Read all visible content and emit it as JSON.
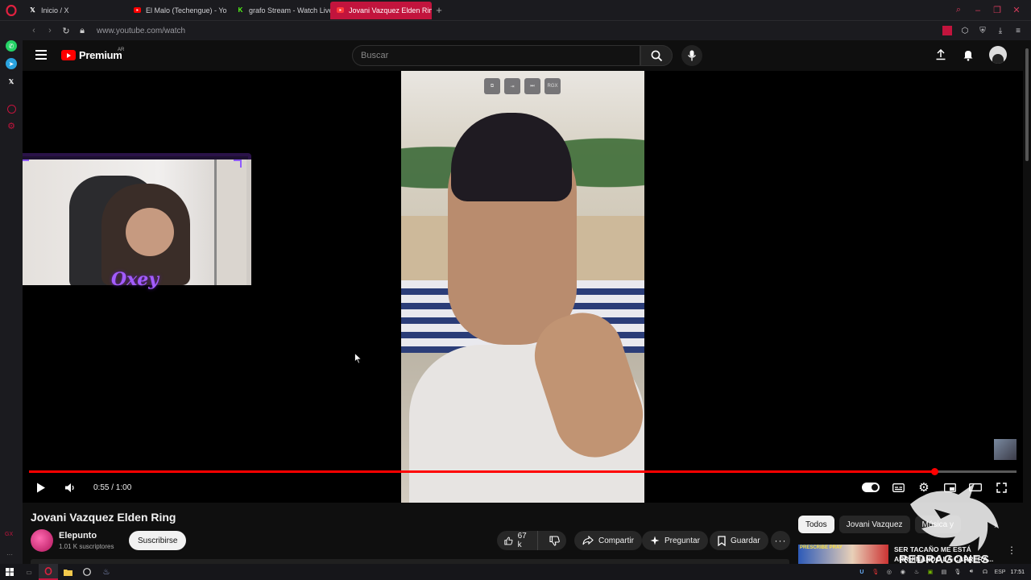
{
  "browser": {
    "tabs": [
      {
        "label": "Inicio / X",
        "icon": "x-logo-icon"
      },
      {
        "label": "El Malo (Techengue) - Yo",
        "icon": "youtube-icon"
      },
      {
        "label": "grafo Stream - Watch Live",
        "icon": "kick-icon"
      },
      {
        "label": "Jovani Vazquez Elden Ring",
        "icon": "youtube-icon",
        "active": true
      }
    ],
    "url": "www.youtube.com/watch",
    "accent_color": "#c2143d"
  },
  "youtube": {
    "logo_text": "Premium",
    "country_code": "AR",
    "search_placeholder": "Buscar",
    "header_icons": [
      "upload-icon",
      "notifications-bell-icon",
      "account-avatar"
    ]
  },
  "player": {
    "time_display": "0:55 / 1:00",
    "progress": 0.917,
    "overlay_tools": [
      "pop-out-icon",
      "exit-icon",
      "next-icon",
      "RGX"
    ],
    "webcam_badge": "Oxey"
  },
  "video": {
    "title": "Jovani Vazquez Elden Ring",
    "channel_name": "Elepunto",
    "channel_subscribers": "1.01 K suscriptores",
    "subscribe_label": "Suscribirse",
    "likes": "67 k",
    "share_label": "Compartir",
    "ask_label": "Preguntar",
    "save_label": "Guardar"
  },
  "recommendations": {
    "chips": [
      "Todos",
      "Jovani Vazquez",
      "Música y"
    ],
    "first_item": {
      "thumbnail_text": "PRESCRIBE PRAY",
      "title": "SER TACAÑO ME ESTÁ ARRUINANDO LA CARRERA..."
    }
  },
  "watermark": {
    "text": "REDRAGONES"
  },
  "taskbar": {
    "language": "ESP",
    "clock": "17:51"
  }
}
